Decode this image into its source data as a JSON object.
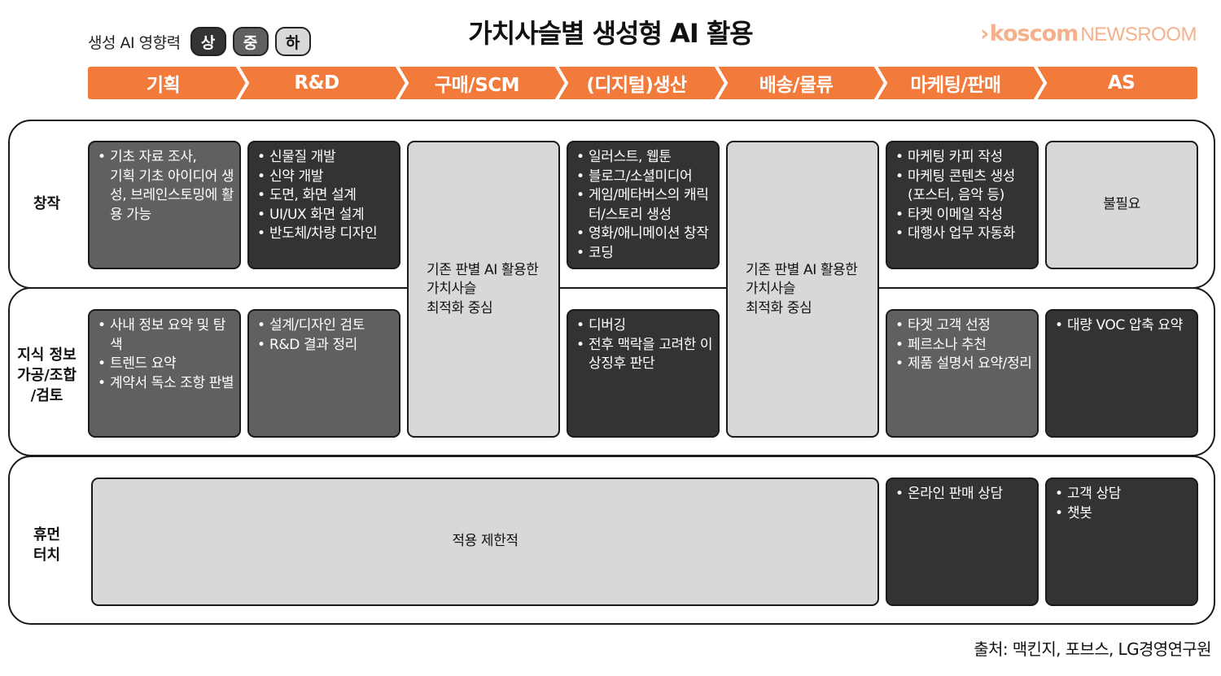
{
  "title": "가치사슬별 생성형 AI 활용",
  "brand": {
    "chevron": "›",
    "name": "koscom",
    "suffix": "NEWSROOM",
    "color": "#f5b08c"
  },
  "legend": {
    "label": "생성 AI 영향력",
    "levels": [
      "상",
      "중",
      "하"
    ],
    "colors": {
      "high": "#333333",
      "mid": "#606060",
      "low": "#d8d8d8"
    }
  },
  "accent_color": "#f27a3a",
  "stages": [
    "기획",
    "R&D",
    "구매/SCM",
    "(디지털)생산",
    "배송/물류",
    "마케팅/판매",
    "AS"
  ],
  "rows": {
    "creation": {
      "label": [
        "창작"
      ]
    },
    "knowledge": {
      "label": [
        "지식 정보",
        "가공/조합",
        "/검토"
      ]
    },
    "human": {
      "label": [
        "휴먼",
        "터치"
      ]
    }
  },
  "cells": {
    "creation_planning": {
      "level": "중",
      "items": [
        "기초 자료 조사,",
        "기획 기초 아이디어 생성, 브레인스토밍에 활용 가능"
      ]
    },
    "creation_rnd": {
      "level": "상",
      "items": [
        "신물질 개발",
        "신약 개발",
        "도면, 화면 설계",
        "UI/UX 화면 설계",
        "반도체/차량 디자인"
      ]
    },
    "scm_merged": {
      "level": "하",
      "lines": [
        "기존 판별 AI 활용한",
        "가치사슬",
        "최적화 중심"
      ]
    },
    "creation_production": {
      "level": "상",
      "items": [
        "일러스트, 웹툰",
        "블로그/소셜미디어",
        "게임/메타버스의 캐릭터/스토리 생성",
        "영화/애니메이션 창작",
        "코딩"
      ]
    },
    "logistics_merged": {
      "level": "하",
      "lines": [
        "기존 판별 AI 활용한",
        "가치사슬",
        "최적화 중심"
      ]
    },
    "creation_marketing": {
      "level": "상",
      "items": [
        "마케팅 카피 작성",
        "마케팅 콘텐츠 생성 (포스터, 음악 등)",
        "타켓 이메일 작성",
        "대행사 업무 자동화"
      ]
    },
    "creation_as": {
      "level": "하",
      "text": "불필요"
    },
    "knowledge_planning": {
      "level": "중",
      "items": [
        "사내 정보 요약 및 탐색",
        "트렌드 요약",
        "계약서 독소 조항 판별"
      ]
    },
    "knowledge_rnd": {
      "level": "중",
      "items": [
        "설계/디자인 검토",
        "R&D 결과 정리"
      ]
    },
    "knowledge_production": {
      "level": "상",
      "items": [
        "디버깅",
        "전후 맥락을 고려한 이상징후 판단"
      ]
    },
    "knowledge_marketing": {
      "level": "중",
      "items": [
        "타겟 고객 선정",
        "페르소나 추천",
        "제품 설명서 요약/정리"
      ]
    },
    "knowledge_as": {
      "level": "상",
      "items": [
        "대량 VOC 압축 요약"
      ]
    },
    "human_merged": {
      "level": "하",
      "text": "적용 제한적"
    },
    "human_marketing": {
      "level": "상",
      "items": [
        "온라인 판매 상담"
      ]
    },
    "human_as": {
      "level": "상",
      "items": [
        "고객 상담",
        "챗봇"
      ]
    }
  },
  "source": "출처: 맥킨지, 포브스, LG경영연구원"
}
